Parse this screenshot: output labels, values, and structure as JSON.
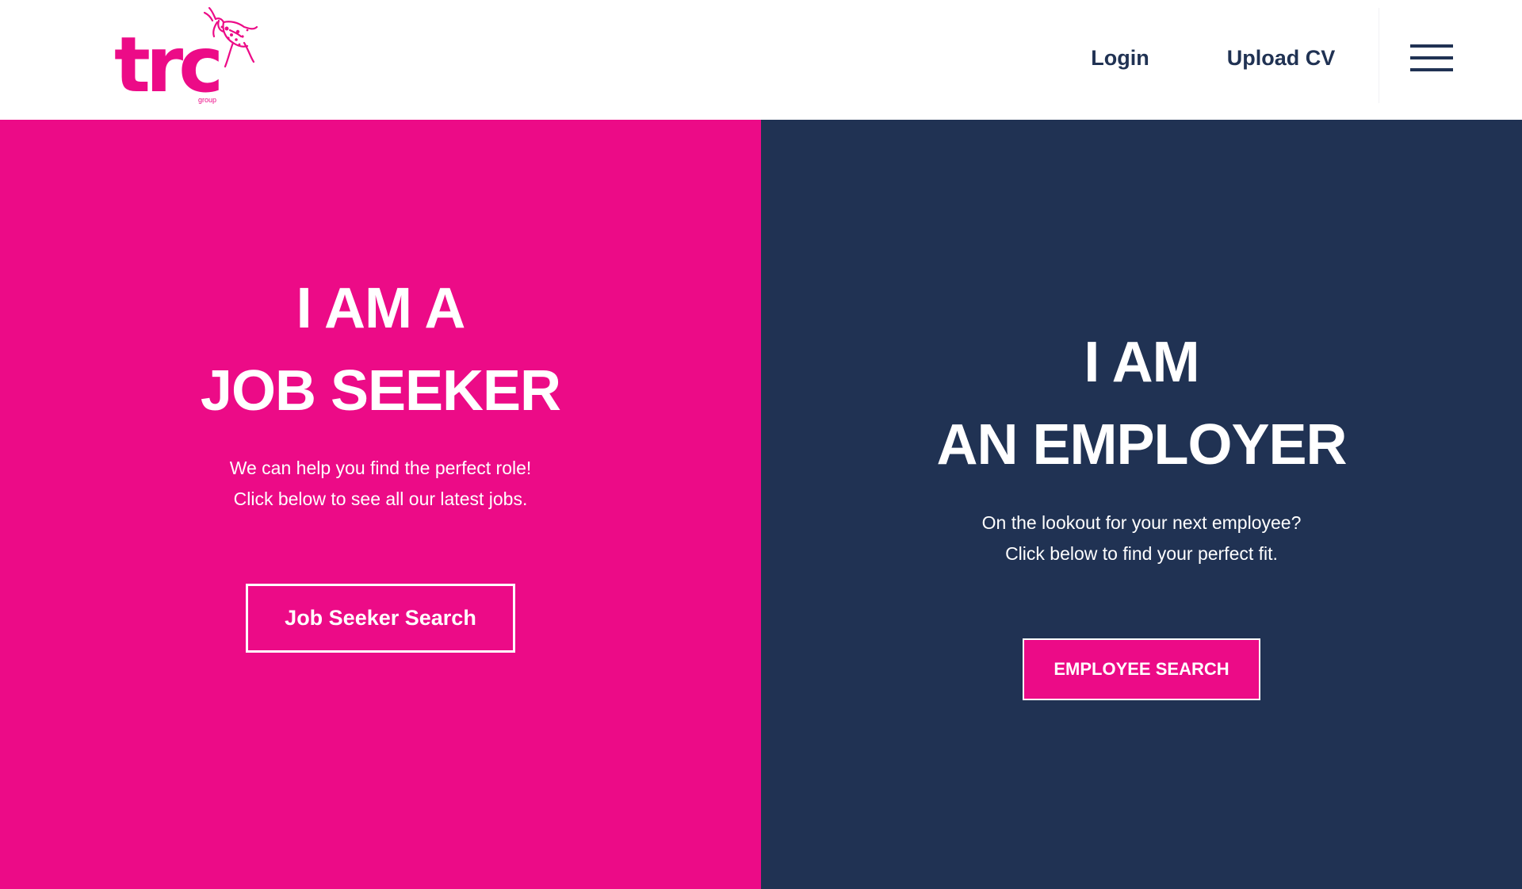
{
  "colors": {
    "brand_pink": "#ec0b87",
    "navy": "#203253",
    "white": "#ffffff",
    "nav_text": "#203253"
  },
  "header": {
    "logo": {
      "text": "trc",
      "subtext": "group",
      "icon": "jumping-goat-icon"
    },
    "nav": {
      "login_label": "Login",
      "upload_cv_label": "Upload CV",
      "menu_icon": "hamburger-menu-icon"
    }
  },
  "job_seeker": {
    "heading_line1": "I AM A",
    "heading_line2": "JOB SEEKER",
    "text_line1": "We can help you find the perfect role!",
    "text_line2": "Click below to see all our latest jobs.",
    "button_label": "Job Seeker Search"
  },
  "employer": {
    "heading_line1": "I AM",
    "heading_line2": "AN EMPLOYER",
    "text_line1": "On the lookout for your next employee?",
    "text_line2": "Click below to find your perfect fit.",
    "button_label": "EMPLOYEE SEARCH"
  }
}
